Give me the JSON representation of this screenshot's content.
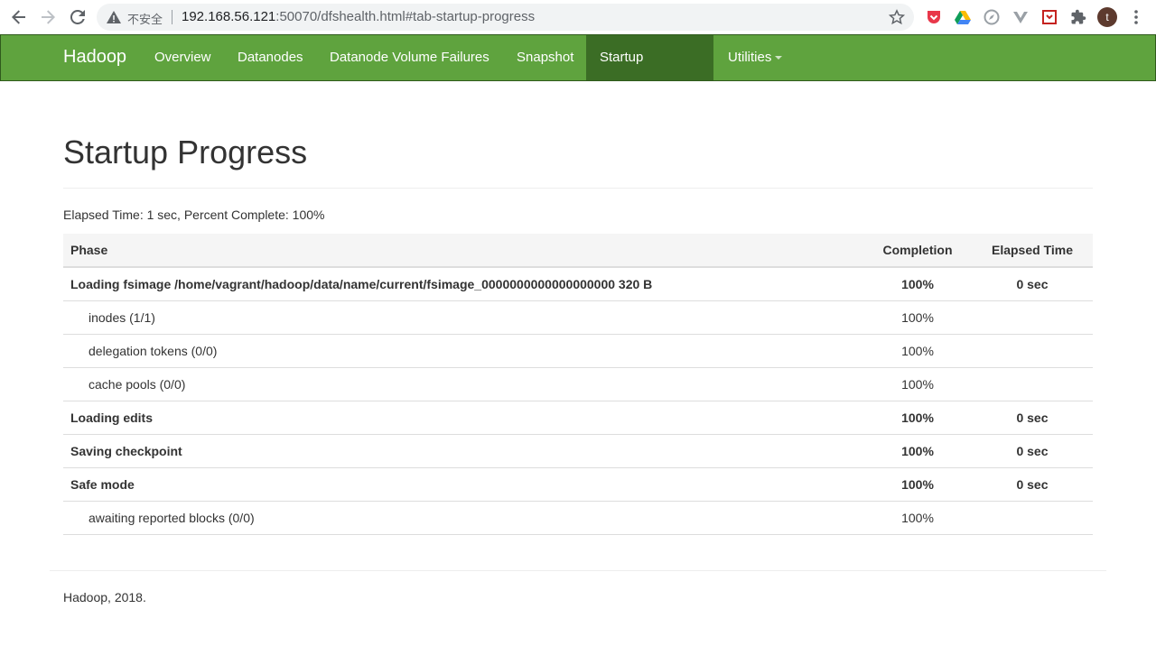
{
  "browser": {
    "security_label": "不安全",
    "url_host": "192.168.56.121",
    "url_rest": ":50070/dfshealth.html#tab-startup-progress",
    "avatar_initial": "t"
  },
  "navbar": {
    "brand": "Hadoop",
    "items": [
      {
        "label": "Overview"
      },
      {
        "label": "Datanodes"
      },
      {
        "label": "Datanode Volume Failures"
      },
      {
        "label": "Snapshot"
      },
      {
        "label": "Startup Progress"
      },
      {
        "label": "Utilities"
      }
    ],
    "colors": {
      "bar": "#5fa33e",
      "active": "#3b6d25"
    }
  },
  "page": {
    "title": "Startup Progress",
    "summary": "Elapsed Time: 1 sec, Percent Complete: 100%"
  },
  "table": {
    "headers": {
      "phase": "Phase",
      "completion": "Completion",
      "elapsed": "Elapsed Time"
    },
    "rows": [
      {
        "label": "Loading fsimage /home/vagrant/hadoop/data/name/current/fsimage_0000000000000000000 320 B",
        "completion": "100%",
        "elapsed": "0 sec"
      },
      {
        "label": "inodes (1/1)",
        "completion": "100%",
        "elapsed": ""
      },
      {
        "label": "delegation tokens (0/0)",
        "completion": "100%",
        "elapsed": ""
      },
      {
        "label": "cache pools (0/0)",
        "completion": "100%",
        "elapsed": ""
      },
      {
        "label": "Loading edits",
        "completion": "100%",
        "elapsed": "0 sec"
      },
      {
        "label": "Saving checkpoint",
        "completion": "100%",
        "elapsed": "0 sec"
      },
      {
        "label": "Safe mode",
        "completion": "100%",
        "elapsed": "0 sec"
      },
      {
        "label": "awaiting reported blocks (0/0)",
        "completion": "100%",
        "elapsed": ""
      }
    ]
  },
  "footer": {
    "text": "Hadoop, 2018."
  }
}
